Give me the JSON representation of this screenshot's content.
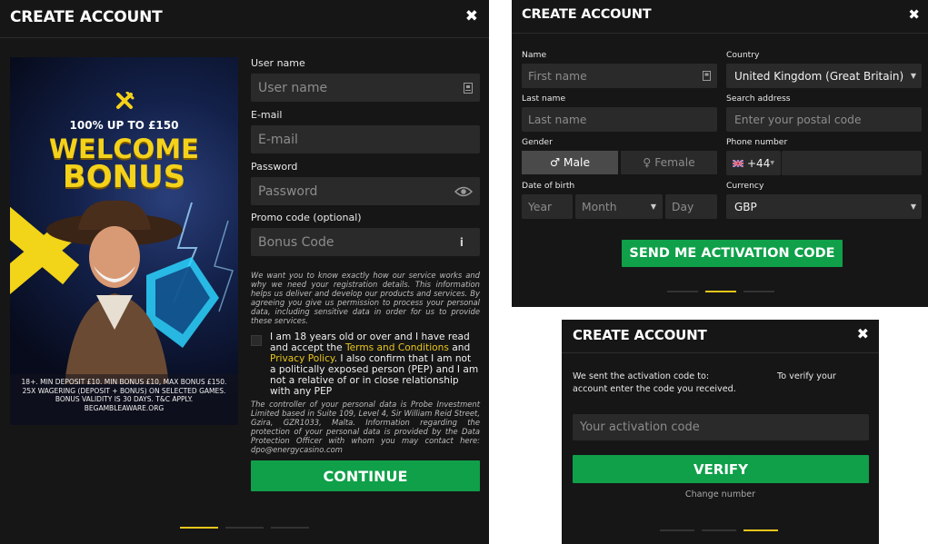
{
  "accent": "#e8c61a",
  "button_color": "#0fa049",
  "panel_background": "#161616",
  "account_form": {
    "title": "CREATE ACCOUNT",
    "close_icon": "close-icon",
    "promo": {
      "headline_top": "100% UP TO £150",
      "headline_welcome": "WELCOME",
      "headline_bonus": "BONUS",
      "terms": [
        "18+. MIN DEPOSIT £10. MIN BONUS £10, MAX BONUS £150.",
        "25X WAGERING (DEPOSIT + BONUS) ON SELECTED GAMES.",
        "BONUS VALIDITY IS 30 DAYS. T&C APPLY.",
        "BEGAMBLEAWARE.ORG"
      ]
    },
    "username": {
      "label": "User name",
      "placeholder": "User name",
      "icon": "id-card-icon"
    },
    "email": {
      "label": "E-mail",
      "placeholder": "E-mail"
    },
    "password": {
      "label": "Password",
      "placeholder": "Password",
      "icon": "eye-icon"
    },
    "promo_code": {
      "label": "Promo code (optional)",
      "placeholder": "Bonus Code",
      "icon": "info-icon"
    },
    "privacy_notice": "We want you to know exactly how our service works and why we need your registration details. This information helps us deliver and develop our products and services. By agreeing you give us permission to process your personal data, including sensitive data in order for us to provide these services.",
    "agreement": {
      "part1": "I am 18 years old or over and I have read and accept the ",
      "terms_link": "Terms and Conditions",
      "and": " and ",
      "privacy_link": "Privacy Policy",
      "part2": ". I also confirm that I am not a politically exposed person (PEP) and I am not a relative of or in close relationship with any PEP"
    },
    "controller_notice": "The controller of your personal data is Probe Investment Limited based in Suite 109, Level 4, Sir William Reid Street, Gzira, GZR1033, Malta. Information regarding the protection of your personal data is provided by the Data Protection Officer with whom you may contact here: dpo@energycasino.com",
    "continue_label": "CONTINUE",
    "step_active": 1
  },
  "details_form": {
    "title": "CREATE ACCOUNT",
    "name_label": "Name",
    "first_name_placeholder": "First name",
    "last_name_label": "Last name",
    "last_name_placeholder": "Last name",
    "gender_label": "Gender",
    "gender_male": "♂ Male",
    "gender_female": "♀ Female",
    "gender_selected": "Male",
    "dob_label": "Date of birth",
    "year_placeholder": "Year",
    "month_placeholder": "Month",
    "day_placeholder": "Day",
    "country_label": "Country",
    "country_value": "United Kingdom (Great Britain)",
    "address_label": "Search address",
    "address_placeholder": "Enter your postal code",
    "phone_label": "Phone number",
    "phone_code": "+44",
    "phone_flag_icon": "uk-flag-icon",
    "currency_label": "Currency",
    "currency_value": "GBP",
    "send_label": "SEND ME ACTIVATION CODE",
    "step_active": 2
  },
  "verify_form": {
    "title": "CREATE ACCOUNT",
    "sent_text_line1": "We sent the activation code to:",
    "sent_text_right": "To verify your",
    "sent_text_line2": "account enter the code you received.",
    "code_placeholder": "Your activation code",
    "verify_label": "VERIFY",
    "change_number": "Change number",
    "step_active": 3
  }
}
